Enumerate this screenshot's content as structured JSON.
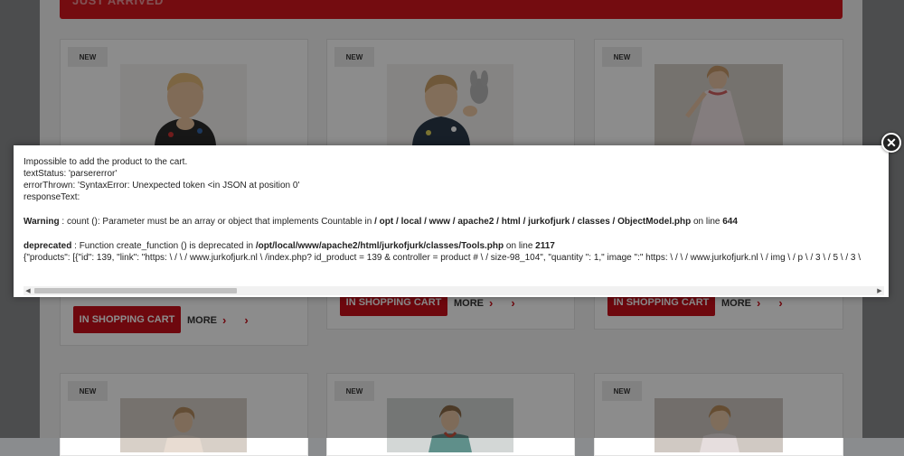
{
  "section": {
    "title": "JUST ARRIVED"
  },
  "products": [
    {
      "badge": "NEW",
      "cart_label": "IN SHOPPING CART",
      "more_label": "MORE"
    },
    {
      "badge": "NEW",
      "cart_label": "IN SHOPPING CART",
      "more_label": "MORE"
    },
    {
      "badge": "NEW",
      "cart_label": "IN SHOPPING CART",
      "more_label": "MORE"
    },
    {
      "badge": "NEW"
    },
    {
      "badge": "NEW"
    },
    {
      "badge": "NEW"
    }
  ],
  "modal": {
    "line1": "Impossible to add the product to the cart.",
    "line2": "textStatus: 'parsererror'",
    "line3": "errorThrown: 'SyntaxError: Unexpected token <in JSON at position 0'",
    "line4": "responseText:",
    "warning_label": "Warning",
    "warning_text": " : count (): Parameter must be an array or object that implements Countable in ",
    "warning_path": "/ opt / local / www / apache2 / html / jurkofjurk / classes / ObjectModel.php",
    "warning_on_line": " on line ",
    "warning_line_no": "644",
    "deprecated_label": "deprecated",
    "deprecated_text": " : Function create_function () is deprecated in ",
    "deprecated_path": "/opt/local/www/apache2/html/jurkofjurk/classes/Tools.php",
    "deprecated_on_line": " on line ",
    "deprecated_line_no": "2117",
    "json_line": "{\"products\": [{\"id\": 139, \"link\": \"https: \\ / \\ / www.jurkofjurk.nl \\ /index.php? id_product = 139 & controller = product # \\ / size-98_104\", \"quantity \": 1,\" image \":\" https: \\ / \\ / www.jurkofjurk.nl \\ / img \\ / p \\ / 3 \\ / 5 \\ / 3 \\"
  },
  "close_icon": "close-circle-icon"
}
